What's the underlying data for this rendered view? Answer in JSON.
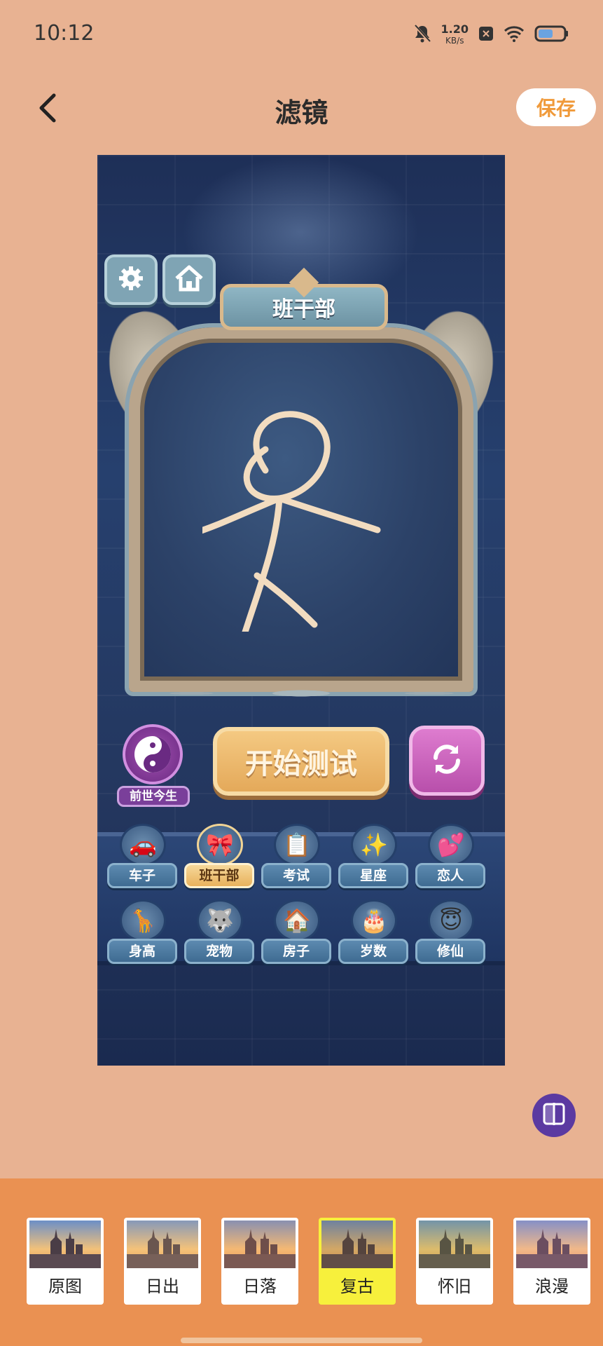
{
  "status": {
    "time": "10:12",
    "speed_value": "1.20",
    "speed_unit": "KB/s",
    "icons": [
      "bell-mute-icon",
      "close-box-icon",
      "wifi-icon",
      "battery-icon"
    ]
  },
  "header": {
    "back_icon": "chevron-left-icon",
    "title": "滤镜",
    "save_label": "保存"
  },
  "preview": {
    "plaque_title": "班干部",
    "yin_label": "前世今生",
    "start_label": "开始测试",
    "categories": [
      {
        "label": "车子",
        "icon": "🚗",
        "active": false
      },
      {
        "label": "班干部",
        "icon": "🎀",
        "active": true
      },
      {
        "label": "考试",
        "icon": "📋",
        "active": false
      },
      {
        "label": "星座",
        "icon": "✨",
        "active": false
      },
      {
        "label": "恋人",
        "icon": "💕",
        "active": false
      },
      {
        "label": "身高",
        "icon": "🦒",
        "active": false
      },
      {
        "label": "宠物",
        "icon": "🐺",
        "active": false
      },
      {
        "label": "房子",
        "icon": "🏠",
        "active": false
      },
      {
        "label": "岁数",
        "icon": "🎂",
        "active": false
      },
      {
        "label": "修仙",
        "icon": "😇",
        "active": false
      }
    ]
  },
  "filters": [
    {
      "label": "原图",
      "selected": false
    },
    {
      "label": "日出",
      "selected": false
    },
    {
      "label": "日落",
      "selected": false
    },
    {
      "label": "复古",
      "selected": true
    },
    {
      "label": "怀旧",
      "selected": false
    },
    {
      "label": "浪漫",
      "selected": false
    }
  ],
  "colors": {
    "background": "#e8b292",
    "filter_strip": "#ea9152",
    "save_text": "#f09a3a",
    "selected_filter": "#f7f03c",
    "compare_button": "#5b3aa1"
  }
}
